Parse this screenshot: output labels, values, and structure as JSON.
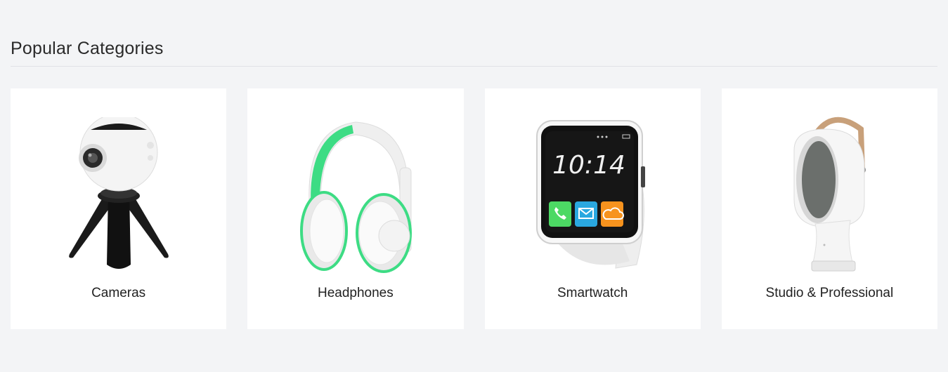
{
  "section": {
    "title": "Popular Categories"
  },
  "categories": [
    {
      "label": "Cameras",
      "icon": "camera-360-icon"
    },
    {
      "label": "Headphones",
      "icon": "headphones-icon"
    },
    {
      "label": "Smartwatch",
      "icon": "smartwatch-icon",
      "watch_time": "10:14"
    },
    {
      "label": "Studio & Professional",
      "icon": "speaker-icon"
    }
  ],
  "colors": {
    "background": "#f3f4f6",
    "card": "#ffffff",
    "headphone_accent": "#3ddc84",
    "watch_call": "#4cd964",
    "watch_mail": "#2aa8e0",
    "watch_cloud": "#f7931e",
    "speaker_strap": "#c8a07a"
  }
}
